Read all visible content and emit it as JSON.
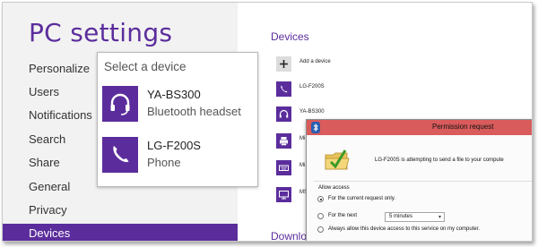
{
  "nav": {
    "title": "PC settings",
    "items": [
      {
        "label": "Personalize"
      },
      {
        "label": "Users"
      },
      {
        "label": "Notifications"
      },
      {
        "label": "Search"
      },
      {
        "label": "Share"
      },
      {
        "label": "General"
      },
      {
        "label": "Privacy"
      },
      {
        "label": "Devices",
        "active": true
      }
    ]
  },
  "devices": {
    "title": "Devices",
    "add_label": "Add a device",
    "list": [
      {
        "name": "LG-F200S",
        "icon": "phone-icon"
      },
      {
        "name": "YA-BS300",
        "icon": "headset-icon"
      },
      {
        "name": "Mi",
        "icon": "printer-icon"
      },
      {
        "name": "Mi",
        "icon": "keyboard-icon"
      },
      {
        "name": "MS",
        "icon": "monitor-icon"
      }
    ],
    "downloads_title": "Downlo"
  },
  "flyout": {
    "title": "Select a device",
    "items": [
      {
        "name": "YA-BS300",
        "type": "Bluetooth headset",
        "icon": "headset-icon"
      },
      {
        "name": "LG-F200S",
        "type": "Phone",
        "icon": "phone-icon"
      }
    ]
  },
  "dialog": {
    "title": "Permission request",
    "message": "LG-F200S is attempting to send a file to your compute",
    "group_label": "Allow access",
    "options": [
      {
        "label": "For the current request only.",
        "selected": true
      },
      {
        "label": "For the next",
        "selected": false
      },
      {
        "label": "Always allow this device access to this service on my computer.",
        "selected": false
      }
    ],
    "duration": "5 minutes",
    "icon": "folder-check-icon"
  },
  "colors": {
    "accent": "#5b2d9c",
    "titlebar": "#d95b5b",
    "nav_bg": "#f2f2f2"
  }
}
